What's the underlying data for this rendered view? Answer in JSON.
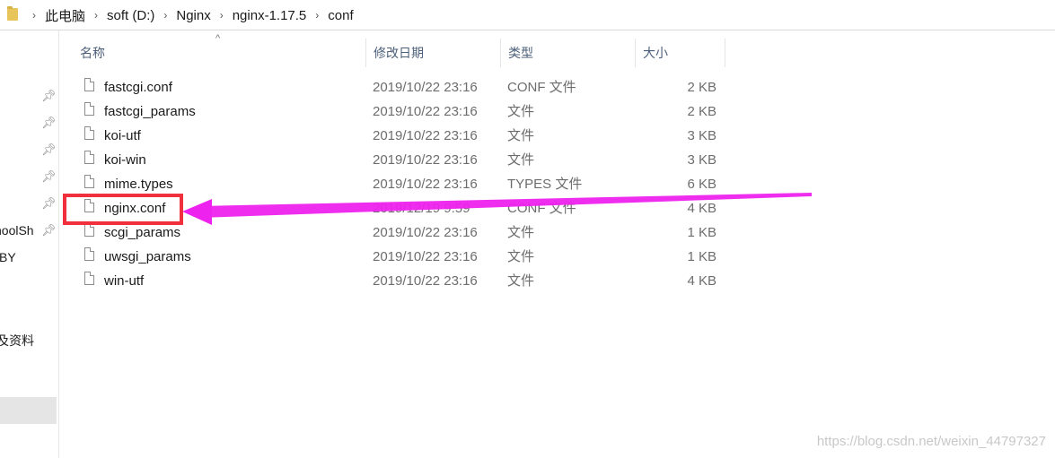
{
  "address_bar": {
    "icon": "folder-icon",
    "crumbs": [
      "此电脑",
      "soft (D:)",
      "Nginx",
      "nginx-1.17.5",
      "conf"
    ]
  },
  "nav": {
    "labels": [
      "noolSh",
      "BY",
      "及资料"
    ]
  },
  "columns": {
    "name": "名称",
    "date": "修改日期",
    "type": "类型",
    "size": "大小"
  },
  "files": [
    {
      "name": "fastcgi.conf",
      "date": "2019/10/22 23:16",
      "type": "CONF 文件",
      "size": "2 KB"
    },
    {
      "name": "fastcgi_params",
      "date": "2019/10/22 23:16",
      "type": "文件",
      "size": "2 KB"
    },
    {
      "name": "koi-utf",
      "date": "2019/10/22 23:16",
      "type": "文件",
      "size": "3 KB"
    },
    {
      "name": "koi-win",
      "date": "2019/10/22 23:16",
      "type": "文件",
      "size": "3 KB"
    },
    {
      "name": "mime.types",
      "date": "2019/10/22 23:16",
      "type": "TYPES 文件",
      "size": "6 KB"
    },
    {
      "name": "nginx.conf",
      "date": "2019/12/19 9:59",
      "type": "CONF 文件",
      "size": "4 KB"
    },
    {
      "name": "scgi_params",
      "date": "2019/10/22 23:16",
      "type": "文件",
      "size": "1 KB"
    },
    {
      "name": "uwsgi_params",
      "date": "2019/10/22 23:16",
      "type": "文件",
      "size": "1 KB"
    },
    {
      "name": "win-utf",
      "date": "2019/10/22 23:16",
      "type": "文件",
      "size": "4 KB"
    }
  ],
  "annotation": {
    "highlight_color": "#f0303c",
    "arrow_color": "#ee22ee"
  },
  "watermark": "https://blog.csdn.net/weixin_44797327"
}
